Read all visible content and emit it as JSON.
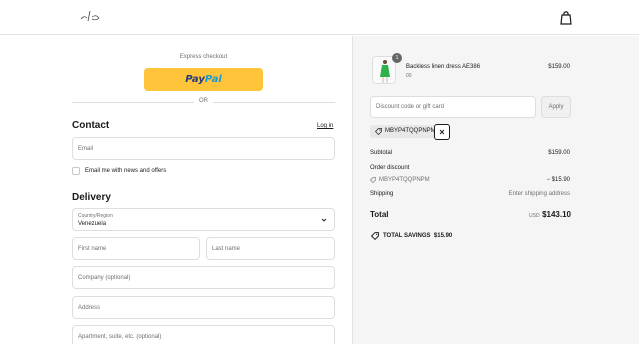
{
  "header": {
    "logo_icon": "brand-logo-icon",
    "bag_icon": "shopping-bag-icon"
  },
  "express": {
    "label": "Express checkout",
    "paypal_part1": "Pay",
    "paypal_part2": "Pal",
    "or_text": "OR"
  },
  "contact": {
    "heading": "Contact",
    "login_link": "Log in",
    "email_placeholder": "Email",
    "newsletter_label": "Email me with news and offers",
    "newsletter_checked": false
  },
  "delivery": {
    "heading": "Delivery",
    "country_label": "Country/Region",
    "country_value": "Venezuela",
    "first_name_placeholder": "First name",
    "last_name_placeholder": "Last name",
    "company_placeholder": "Company (optional)",
    "address_placeholder": "Address",
    "apartment_placeholder": "Apartment, suite, etc. (optional)"
  },
  "summary": {
    "product": {
      "name": "Backless linen dress AE386",
      "variant": "00",
      "price": "$159.00",
      "quantity": "1"
    },
    "discount_placeholder": "Discount code or gift card",
    "apply_label": "Apply",
    "applied_code": "MBYP4TQQPNPM",
    "subtotal_label": "Subtotal",
    "subtotal_value": "$159.00",
    "order_discount_label": "Order discount",
    "discount_code": "MBYP4TQQPNPM",
    "discount_value": "− $15.90",
    "shipping_label": "Shipping",
    "shipping_value": "Enter shipping address",
    "total_label": "Total",
    "currency": "USD",
    "total_value": "$143.10",
    "savings_label": "TOTAL SAVINGS",
    "savings_value": "$15.90"
  },
  "colors": {
    "paypal_yellow": "#ffc439",
    "paypal_dark_blue": "#253b80",
    "paypal_light_blue": "#179bd7",
    "summary_bg": "#f5f5f5"
  }
}
